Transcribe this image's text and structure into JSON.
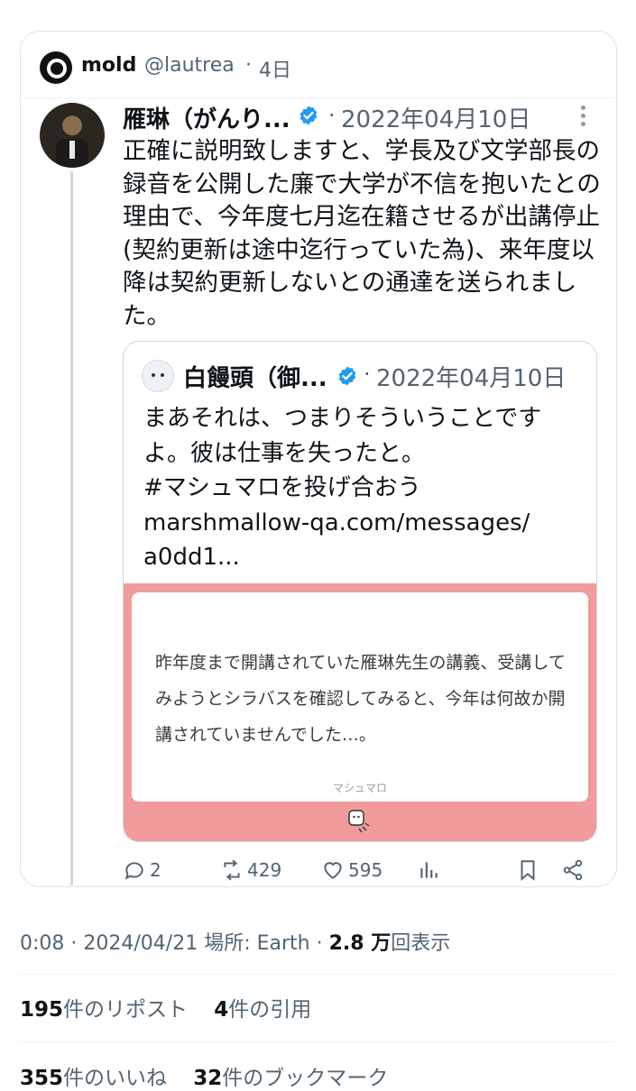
{
  "header": {
    "name": "mold",
    "handle": "@lautrea",
    "separator": "·",
    "time": "4日"
  },
  "tweet": {
    "author_name": "雁琳（がんり...",
    "separator": "·",
    "date": "2022年04月10日",
    "body": "正確に説明致しますと、学長及び文学部長の録音を公開した廉で大学が不信を抱いたとの理由で、今年度七月迄在籍させるが出講停止(契約更新は途中迄行っていた為)、来年度以降は契約更新しないとの通達を送られました。"
  },
  "quote": {
    "author_name": "白饅頭（御...",
    "separator": "·",
    "date": "2022年04月10日",
    "line1": "まあそれは、つまりそういうことです",
    "line2": "よ。彼は仕事を失ったと。",
    "hashtag": "#マシュマロを投げ合おう",
    "link1": "marshmallow-qa.com/messages/",
    "link2": "a0dd1..."
  },
  "marshmallow": {
    "message": "昨年度まで開講されていた雁琳先生の講義、受講してみようとシラバスを確認してみると、今年は何故か開講されていませんでした…。",
    "brand": "マシュマロ",
    "bg_color": "#f19b9c"
  },
  "actions": {
    "replies": "2",
    "reposts": "429",
    "likes": "595"
  },
  "meta": {
    "time": "0:08",
    "sep1": "·",
    "date": "2024/04/21",
    "location": "場所: Earth",
    "sep2": "·",
    "views": "2.8 万",
    "views_label": "回表示"
  },
  "stats": {
    "reposts_count": "195",
    "reposts_label": "件のリポスト",
    "quotes_count": "4",
    "quotes_label": "件の引用",
    "likes_count": "355",
    "likes_label": "件のいいね",
    "bookmarks_count": "32",
    "bookmarks_label": "件のブックマーク"
  },
  "colors": {
    "verified": "#1d9bf0",
    "muted": "#536471",
    "accent_pink": "#f19b9c"
  }
}
